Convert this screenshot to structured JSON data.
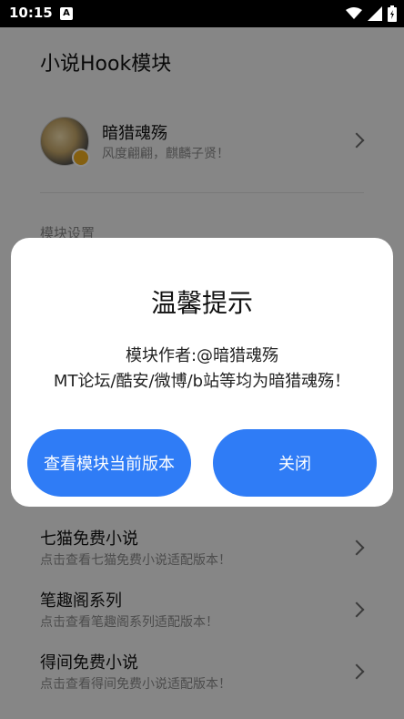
{
  "status_bar": {
    "time": "10:15",
    "a_icon": "A",
    "icons": [
      "wifi-icon",
      "signal-icon",
      "battery-icon"
    ]
  },
  "app": {
    "title": "小说Hook模块",
    "profile": {
      "name": "暗猎魂殇",
      "motto": "风度翩翩，麒麟子贤！"
    },
    "section_title": "模块设置",
    "items": [
      {
        "title": "七猫免费小说",
        "subtitle": "点击查看七猫免费小说适配版本！"
      },
      {
        "title": "笔趣阁系列",
        "subtitle": "点击查看笔趣阁系列适配版本！"
      },
      {
        "title": "得间免费小说",
        "subtitle": "点击查看得间免费小说适配版本！"
      }
    ]
  },
  "dialog": {
    "title": "温馨提示",
    "message_line1": "模块作者:@暗猎魂殇",
    "message_line2": "MT论坛/酷安/微博/b站等均为暗猎魂殇！",
    "btn_view": "查看模块当前版本",
    "btn_close": "关闭",
    "accent_color": "#2f7cf6"
  }
}
